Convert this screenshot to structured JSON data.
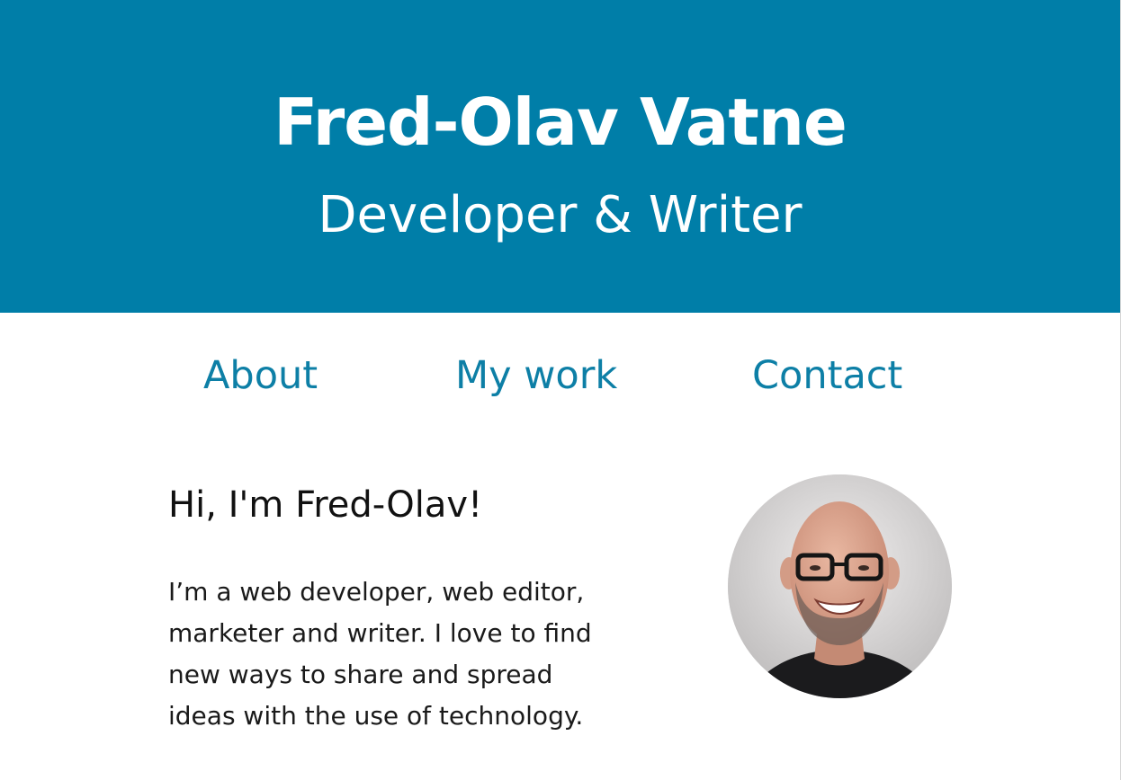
{
  "header": {
    "name": "Fred-Olav Vatne",
    "tagline": "Developer & Writer"
  },
  "nav": {
    "items": [
      {
        "label": "About"
      },
      {
        "label": "My work"
      },
      {
        "label": "Contact"
      }
    ]
  },
  "intro": {
    "heading": "Hi, I'm Fred-Olav!",
    "bio_lines": [
      "I’m a web developer, web editor,",
      "marketer and writer. I love to find",
      "new ways to share and spread",
      "ideas with the use of technology."
    ]
  },
  "colors": {
    "brand": "#007ea8",
    "link": "#0d7fa6",
    "text": "#111111",
    "background": "#ffffff"
  },
  "icons": {
    "avatar": "profile-photo"
  }
}
